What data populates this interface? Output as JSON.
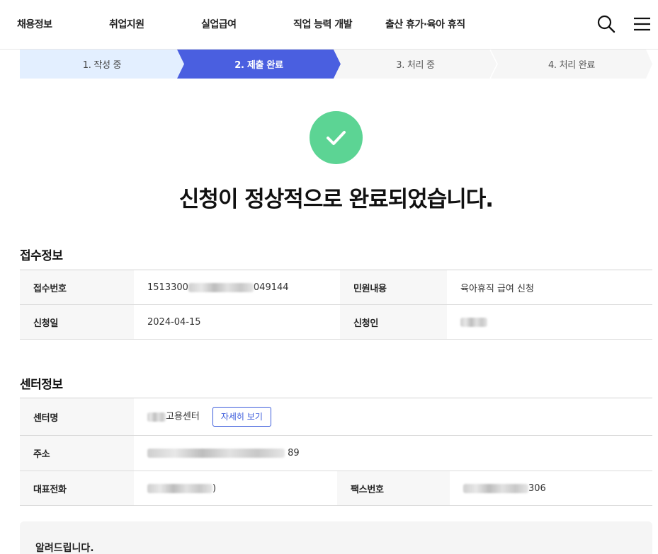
{
  "nav": {
    "items": [
      {
        "label": "채용정보"
      },
      {
        "label": "취업지원"
      },
      {
        "label": "실업급여"
      },
      {
        "label": "직업 능력 개발"
      },
      {
        "label": "출산 휴가·육아 휴직"
      }
    ]
  },
  "stepper": {
    "steps": [
      {
        "label": "1. 작성 중",
        "state": "done"
      },
      {
        "label": "2. 제출 완료",
        "state": "current"
      },
      {
        "label": "3. 처리 중",
        "state": "pending"
      },
      {
        "label": "4. 처리 완료",
        "state": "pending"
      }
    ]
  },
  "result": {
    "headline": "신청이 정상적으로 완료되었습니다."
  },
  "receipt": {
    "title": "접수정보",
    "receipt_no_label": "접수번호",
    "receipt_no_prefix": "1513300",
    "receipt_no_suffix": "049144",
    "content_label": "민원내용",
    "content_value": "육아휴직 급여 신청",
    "date_label": "신청일",
    "date_value": "2024-04-15",
    "applicant_label": "신청인"
  },
  "center": {
    "title": "센터정보",
    "name_label": "센터명",
    "name_suffix": "고용센터",
    "detail_button": "자세히 보기",
    "address_label": "주소",
    "address_suffix": "89",
    "phone_label": "대표전화",
    "phone_suffix": ")",
    "fax_label": "팩스번호",
    "fax_suffix": "306"
  },
  "notice": {
    "title": "알려드립니다."
  },
  "colors": {
    "primary": "#4a5fe0",
    "step_done": "#e3efff",
    "step_pending": "#f6f6f6",
    "success": "#5cd494"
  }
}
